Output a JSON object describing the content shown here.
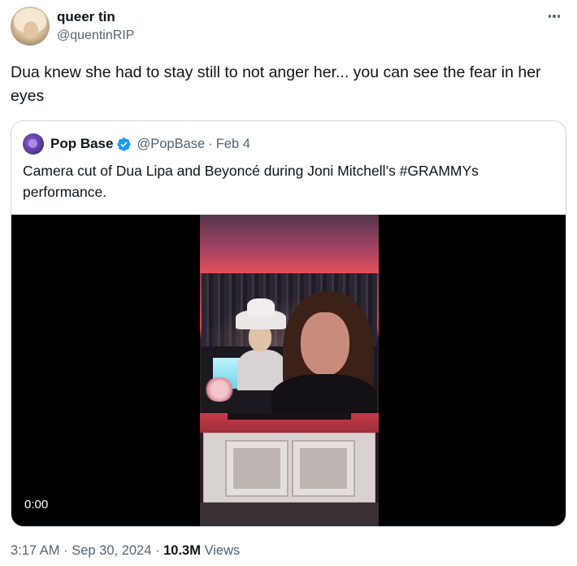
{
  "author": {
    "name": "queer tin",
    "handle": "@quentinRIP"
  },
  "tweet": {
    "text": "Dua knew she had to stay still to not anger her... you can see the fear in her eyes"
  },
  "quoted": {
    "name": "Pop Base",
    "handle": "@PopBase",
    "separator": "·",
    "date": "Feb 4",
    "text": "Camera cut of Dua Lipa and Beyoncé during Joni Mitchell’s #GRAMMYs performance.",
    "video_time": "0:00",
    "verified_icon": "verified-badge-icon"
  },
  "meta": {
    "time": "3:17 AM",
    "separator": "·",
    "date": "Sep 30, 2024",
    "views_count": "10.3M",
    "views_label": "Views"
  },
  "colors": {
    "text": "#0f1419",
    "secondary": "#536471",
    "verified": "#1d9bf0",
    "border": "#cfd9de"
  }
}
